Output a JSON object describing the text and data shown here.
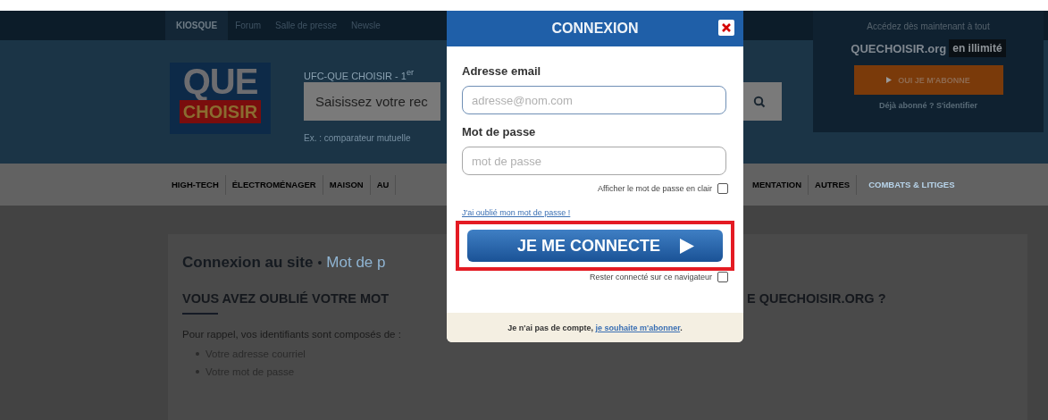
{
  "top_bar": {
    "links": [
      {
        "label": "KIOSQUE",
        "selected": true
      },
      {
        "label": "Forum",
        "selected": false
      },
      {
        "label": "Salle de presse",
        "selected": false
      },
      {
        "label": "Newsle",
        "selected": false
      }
    ]
  },
  "header": {
    "logo": {
      "line1": "QUE",
      "line2": "CHOISIR"
    },
    "tagline": "UFC-QUE CHOISIR - 1$^{er}$",
    "search": {
      "placeholder": "Saisissez votre rec"
    },
    "example": "Ex. : comparateur mutuelle"
  },
  "subscribe": {
    "intro": "Accédez dès maintenant à tout",
    "brand": "QUECHOISIR.org",
    "badge": "en illimité",
    "button": "OUI JE M'ABONNE",
    "login": "Déjà abonné ? S'identifier"
  },
  "nav": {
    "left": [
      {
        "label": "HIGH-TECH",
        "kind": "plain"
      },
      {
        "label": "ÉLECTROMÉNAGER",
        "kind": "plain"
      },
      {
        "label": "MAISON",
        "kind": "plain"
      },
      {
        "label": "AU",
        "kind": "plain"
      }
    ],
    "right": [
      {
        "label": "MENTATION",
        "kind": "plain"
      },
      {
        "label": "AUTRES",
        "kind": "plain"
      },
      {
        "label": "COMBATS & LITIGES",
        "kind": "highlight"
      }
    ]
  },
  "content": {
    "title": "Connexion au site",
    "separator": "•",
    "subtitle": "Mot de p",
    "heading_left": "VOUS AVEZ OUBLIÉ VOTRE MOT",
    "heading_right": "E QUECHOISIR.ORG ?",
    "intro": "Pour rappel, vos identifiants sont composés de :",
    "list": [
      "Votre adresse courriel",
      "Votre mot de passe"
    ]
  },
  "modal": {
    "title": "CONNEXION",
    "email": {
      "label": "Adresse email",
      "placeholder": "adresse@nom.com",
      "focused": true
    },
    "password": {
      "label": "Mot de passe",
      "placeholder": "mot de passe",
      "focused": false
    },
    "show_password": {
      "label": "Afficher le mot de passe en clair",
      "checked": false
    },
    "forgot": "J'ai oublié mon mot de passe !",
    "submit": {
      "label": "JE ME CONNECTE",
      "highlighted": true
    },
    "remember": {
      "label": "Rester connecté sur ce navigateur",
      "checked": false
    },
    "footer": {
      "text": "Je n'ai pas de compte, ",
      "link": "je souhaite m'abonner",
      "end": "."
    }
  }
}
